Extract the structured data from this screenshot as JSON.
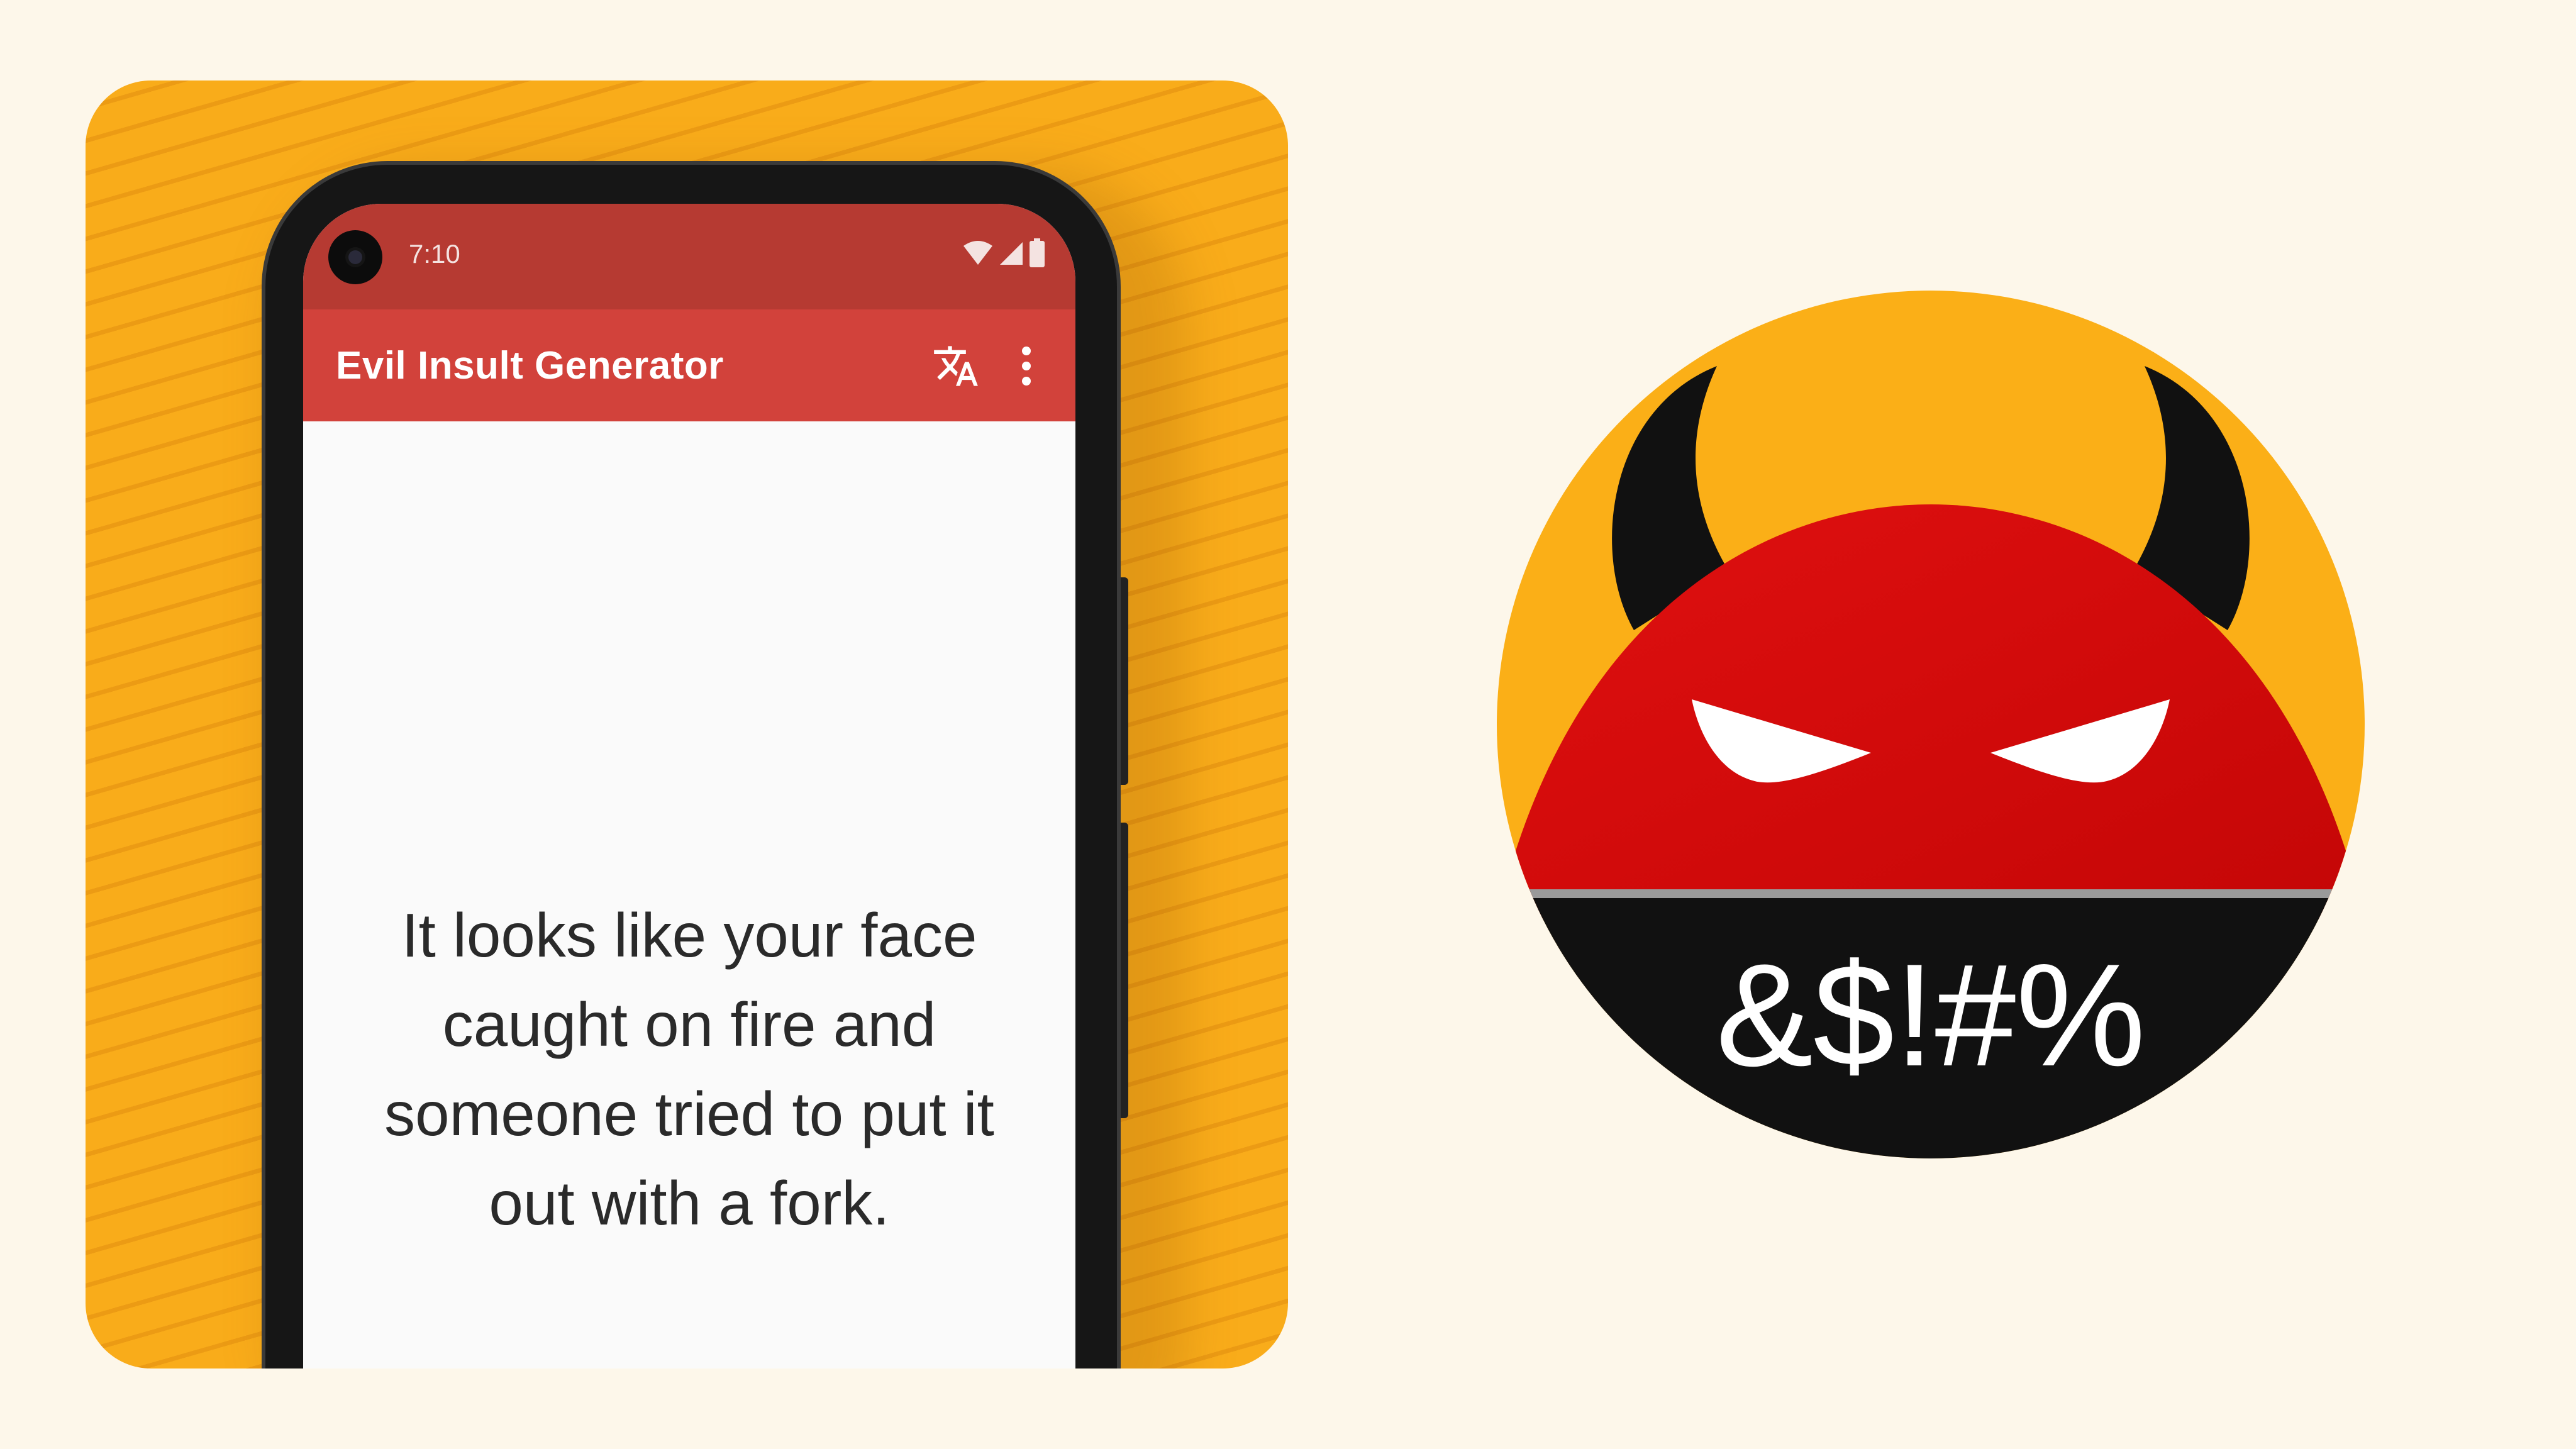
{
  "phone": {
    "status_bar": {
      "time": "7:10",
      "icons": [
        "wifi-icon",
        "signal-icon",
        "battery-icon"
      ]
    },
    "app_bar": {
      "title": "Evil Insult Generator",
      "actions": [
        "translate-icon",
        "more-vert-icon"
      ]
    },
    "insult": {
      "text": "It looks like your face caught on fire and someone tried to put it out with a fork."
    }
  },
  "app_icon": {
    "symbols": "&$!#%",
    "icon": "devil-face-icon"
  },
  "colors": {
    "background": "#fdf7ea",
    "card": "#f9ac1a",
    "status_bar": "#b63a32",
    "app_bar": "#d2423b",
    "devil_red": "#d40d0d",
    "devil_black": "#111111"
  }
}
